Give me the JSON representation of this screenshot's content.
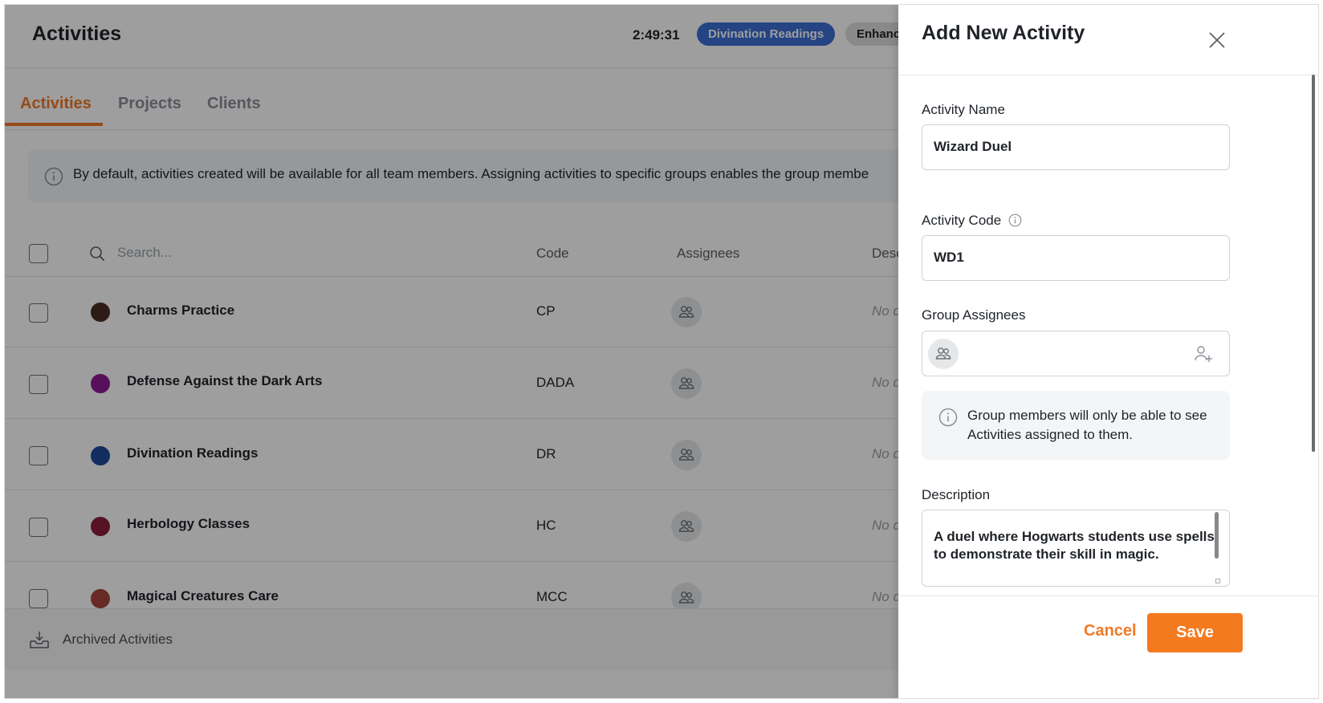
{
  "header": {
    "title": "Activities",
    "timer": "2:49:31",
    "current_activity": "Divination Readings",
    "current_project": "Enhancing the J"
  },
  "tabs": [
    {
      "label": "Activities",
      "active": true
    },
    {
      "label": "Projects",
      "active": false
    },
    {
      "label": "Clients",
      "active": false
    }
  ],
  "info_banner": {
    "text": "By default, activities created will be available for all team members. Assigning activities to specific groups enables the group membe"
  },
  "table": {
    "search_placeholder": "Search...",
    "columns": [
      "Code",
      "Assignees",
      "Desc"
    ],
    "rows": [
      {
        "name": "Charms Practice",
        "code": "CP",
        "color": "#4a2e22",
        "description": "No d"
      },
      {
        "name": "Defense Against the Dark Arts",
        "code": "DADA",
        "color": "#8e1b96",
        "description": "No d"
      },
      {
        "name": "Divination Readings",
        "code": "DR",
        "color": "#1d4a9a",
        "description": "No d"
      },
      {
        "name": "Herbology Classes",
        "code": "HC",
        "color": "#8a1f3a",
        "description": "No d"
      },
      {
        "name": "Magical Creatures Care",
        "code": "MCC",
        "color": "#a8453a",
        "description": "No d"
      }
    ]
  },
  "footer": {
    "archived_label": "Archived Activities"
  },
  "drawer": {
    "title": "Add New Activity",
    "activity_name_label": "Activity Name",
    "activity_name_value": "Wizard Duel",
    "activity_code_label": "Activity Code",
    "activity_code_value": "WD1",
    "group_assignees_label": "Group Assignees",
    "group_notice": "Group members will only be able to see Activities assigned to them.",
    "description_label": "Description",
    "description_value": "A duel where Hogwarts students use spells to demonstrate their skill in magic.",
    "cancel_label": "Cancel",
    "save_label": "Save"
  },
  "colors": {
    "accent": "#f47a20",
    "pill_blue": "#3b6fd6",
    "overlay": "rgba(0,0,0,0.38)"
  }
}
